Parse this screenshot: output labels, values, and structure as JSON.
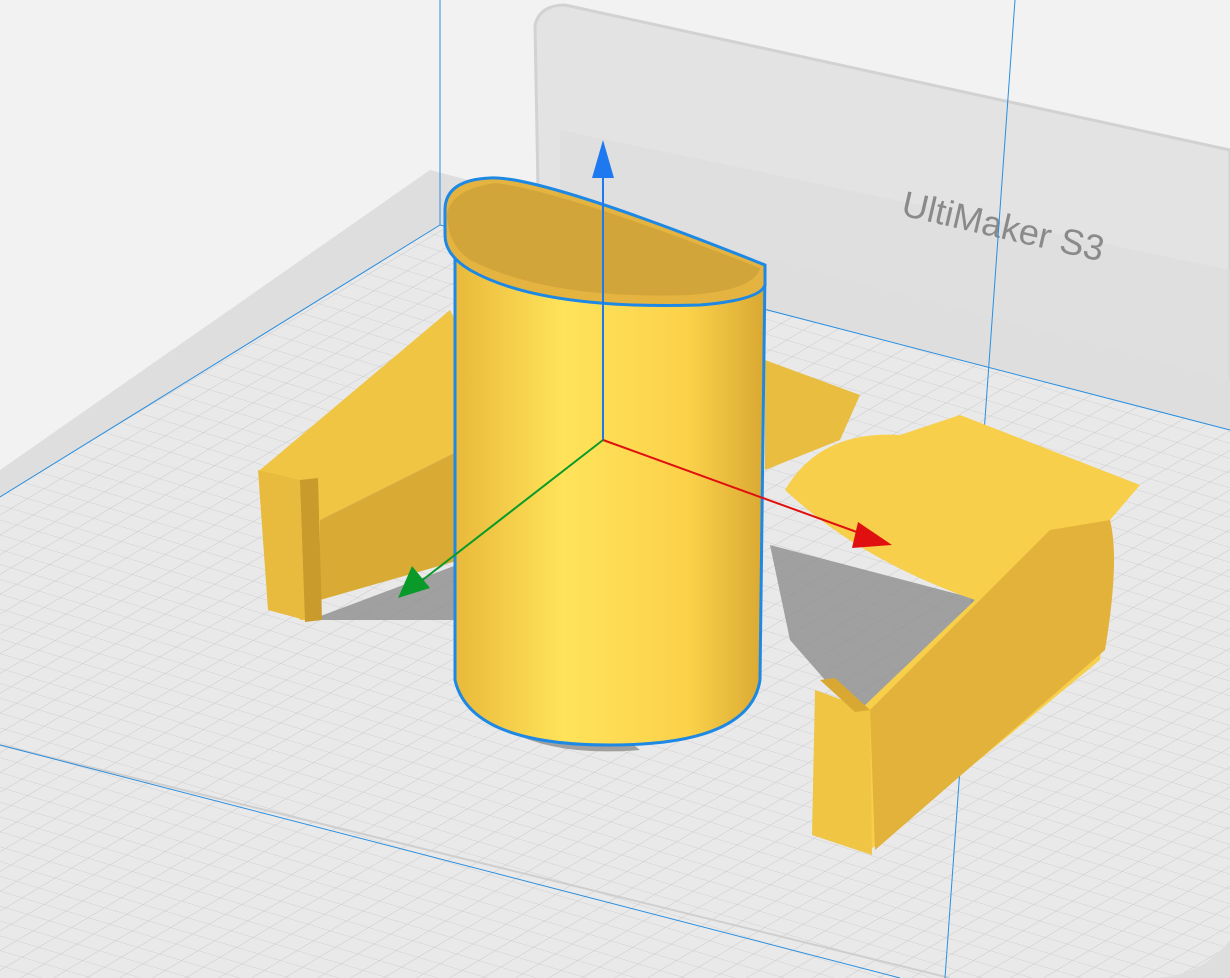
{
  "viewport": {
    "printer_label": "UltiMaker S3"
  },
  "colors": {
    "background": "#f2f2f2",
    "model": "#f7cf4a",
    "selection_outline": "#1e88e5",
    "axis_x": "#e01010",
    "axis_y": "#0a9a2a",
    "axis_z": "#1e78f0",
    "build_volume": "#2a8fe0"
  }
}
